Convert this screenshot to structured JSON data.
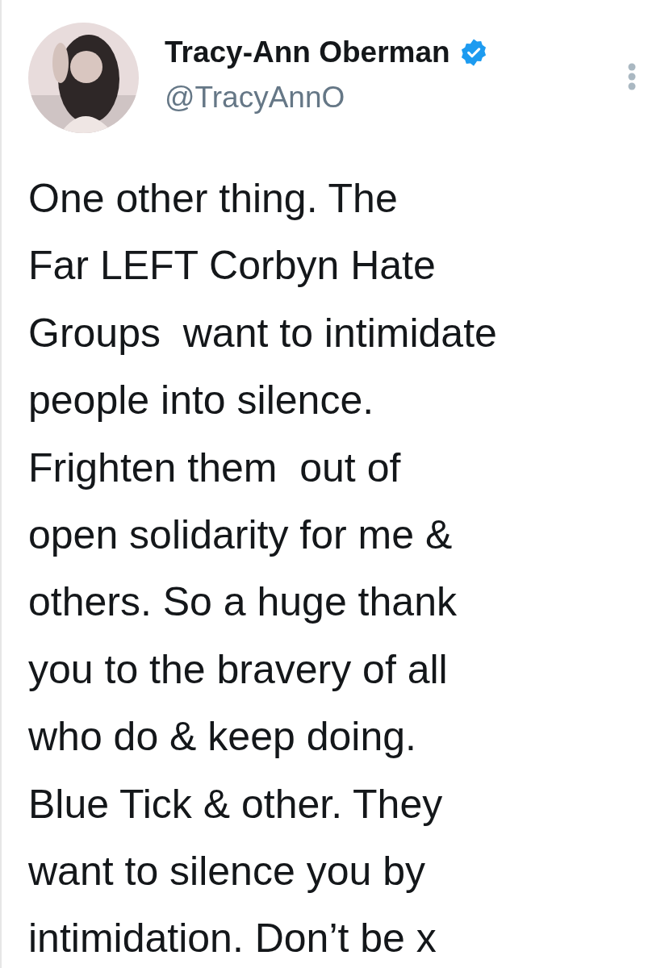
{
  "author": {
    "name": "Tracy-Ann Oberman",
    "verified": true,
    "handle": "@TracyAnnO"
  },
  "tweet": {
    "text": "One other thing. The\nFar LEFT Corbyn Hate\nGroups  want to intimidate\npeople into silence.\nFrighten them  out of\nopen solidarity for me &\nothers. So a huge thank\nyou to the bravery of all\nwho do & keep doing.\nBlue Tick & other. They\nwant to silence you by\nintimidation. Don’t be x"
  }
}
